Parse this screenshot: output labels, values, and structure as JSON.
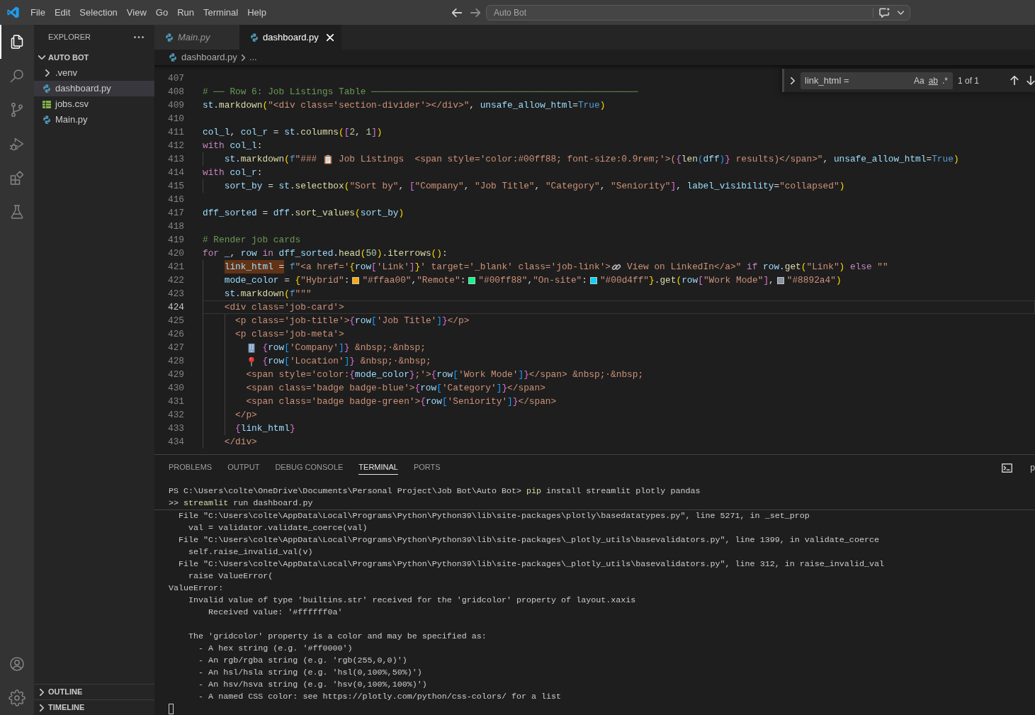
{
  "title_bar": {
    "menu": [
      "File",
      "Edit",
      "Selection",
      "View",
      "Go",
      "Run",
      "Terminal",
      "Help"
    ],
    "command_center": "Auto Bot"
  },
  "activity_bar": {
    "items": [
      {
        "kind": "files",
        "selected": true
      },
      {
        "kind": "search",
        "selected": false
      },
      {
        "kind": "source_control",
        "selected": false
      },
      {
        "kind": "run_debug",
        "selected": false
      },
      {
        "kind": "extensions",
        "selected": false
      },
      {
        "kind": "testing",
        "selected": false
      }
    ],
    "bottom": [
      {
        "kind": "account"
      },
      {
        "kind": "settings"
      }
    ]
  },
  "sidebar": {
    "title": "EXPLORER",
    "root": {
      "name": "AUTO BOT",
      "expanded": true
    },
    "items": [
      {
        "name": ".venv",
        "kind": "folder",
        "expanded": false,
        "selected": false
      },
      {
        "name": "dashboard.py",
        "kind": "python",
        "selected": true
      },
      {
        "name": "jobs.csv",
        "kind": "csv",
        "selected": false
      },
      {
        "name": "Main.py",
        "kind": "python",
        "selected": false
      }
    ],
    "sections": [
      {
        "name": "OUTLINE",
        "expanded": false
      },
      {
        "name": "TIMELINE",
        "expanded": false
      }
    ]
  },
  "editor": {
    "tabs": [
      {
        "label": "Main.py",
        "selected": false,
        "preview": true
      },
      {
        "label": "dashboard.py",
        "selected": true,
        "preview": false
      }
    ],
    "breadcrumb": [
      "dashboard.py",
      "..."
    ],
    "find": {
      "query": "link_html =",
      "options": [
        {
          "label": "Aa",
          "underlined": false
        },
        {
          "label": "ab",
          "underlined": true
        },
        {
          "label": ".*",
          "underlined": false
        }
      ],
      "result": "1 of 1"
    },
    "lines": [
      {
        "number": "407",
        "current": false
      },
      {
        "number": "408",
        "current": false,
        "tokens": [
          {
            "kind": "comment",
            "text": "# ── Row 6: Job Listings Table ─────────────────────────────────────────────────"
          }
        ]
      },
      {
        "number": "409",
        "current": false,
        "tokens": [
          {
            "kind": "var",
            "text": "st."
          },
          {
            "kind": "func",
            "text": "markdown"
          },
          {
            "kind": "b1",
            "text": "("
          },
          {
            "kind": "str",
            "text": "\"<div class='section-divider'></div>\""
          },
          {
            "kind": "plain",
            "text": ", "
          },
          {
            "kind": "var",
            "text": "unsafe_allow_html"
          },
          {
            "kind": "plain",
            "text": "="
          },
          {
            "kind": "const",
            "text": "True"
          },
          {
            "kind": "b1",
            "text": ")"
          }
        ]
      },
      {
        "number": "410",
        "current": false
      },
      {
        "number": "411",
        "current": false,
        "tokens": [
          {
            "kind": "var",
            "text": "col_l"
          },
          {
            "kind": "plain",
            "text": ", "
          },
          {
            "kind": "var",
            "text": "col_r"
          },
          {
            "kind": "plain",
            "text": " = "
          },
          {
            "kind": "var",
            "text": "st."
          },
          {
            "kind": "func",
            "text": "columns"
          },
          {
            "kind": "b1",
            "text": "("
          },
          {
            "kind": "b2",
            "text": "["
          },
          {
            "kind": "num",
            "text": "2"
          },
          {
            "kind": "plain",
            "text": ", "
          },
          {
            "kind": "num",
            "text": "1"
          },
          {
            "kind": "b2",
            "text": "]"
          },
          {
            "kind": "b1",
            "text": ")"
          }
        ]
      },
      {
        "number": "412",
        "current": false,
        "tokens": [
          {
            "kind": "kw",
            "text": "with"
          },
          {
            "kind": "var",
            "text": " col_l"
          },
          {
            "kind": "plain",
            "text": ":"
          }
        ],
        "children": [
          {
            "number": "413",
            "current": false,
            "tokens": [
              {
                "kind": "var",
                "text": "st."
              },
              {
                "kind": "func",
                "text": "markdown"
              },
              {
                "kind": "b1",
                "text": "("
              },
              {
                "kind": "const",
                "text": "f"
              },
              {
                "kind": "str",
                "text": "\"### "
              },
              {
                "kind": "clipboard"
              },
              {
                "kind": "str",
                "text": " Job Listings  <span style='color:#00ff88; font-size:0.9rem;'>("
              },
              {
                "kind": "b2",
                "text": "{"
              },
              {
                "kind": "func",
                "text": "len"
              },
              {
                "kind": "b3",
                "text": "("
              },
              {
                "kind": "var",
                "text": "dff"
              },
              {
                "kind": "b3",
                "text": ")"
              },
              {
                "kind": "b2",
                "text": "}"
              },
              {
                "kind": "str",
                "text": " results)</span>\""
              },
              {
                "kind": "plain",
                "text": ", "
              },
              {
                "kind": "var",
                "text": "unsafe_allow_html"
              },
              {
                "kind": "plain",
                "text": "="
              },
              {
                "kind": "const",
                "text": "True"
              },
              {
                "kind": "b1",
                "text": ")"
              }
            ]
          }
        ]
      },
      {
        "number": "414",
        "current": false,
        "tokens": [
          {
            "kind": "kw",
            "text": "with"
          },
          {
            "kind": "var",
            "text": " col_r"
          },
          {
            "kind": "plain",
            "text": ":"
          }
        ],
        "children": [
          {
            "number": "415",
            "current": false,
            "tokens": [
              {
                "kind": "var",
                "text": "sort_by"
              },
              {
                "kind": "plain",
                "text": " = "
              },
              {
                "kind": "var",
                "text": "st."
              },
              {
                "kind": "func",
                "text": "selectbox"
              },
              {
                "kind": "b1",
                "text": "("
              },
              {
                "kind": "str",
                "text": "\"Sort by\""
              },
              {
                "kind": "plain",
                "text": ", "
              },
              {
                "kind": "b2",
                "text": "["
              },
              {
                "kind": "str",
                "text": "\"Company\""
              },
              {
                "kind": "plain",
                "text": ", "
              },
              {
                "kind": "str",
                "text": "\"Job Title\""
              },
              {
                "kind": "plain",
                "text": ", "
              },
              {
                "kind": "str",
                "text": "\"Category\""
              },
              {
                "kind": "plain",
                "text": ", "
              },
              {
                "kind": "str",
                "text": "\"Seniority\""
              },
              {
                "kind": "b2",
                "text": "]"
              },
              {
                "kind": "plain",
                "text": ", "
              },
              {
                "kind": "var",
                "text": "label_visibility"
              },
              {
                "kind": "plain",
                "text": "="
              },
              {
                "kind": "str",
                "text": "\"collapsed\""
              },
              {
                "kind": "b1",
                "text": ")"
              }
            ]
          }
        ]
      },
      {
        "number": "416",
        "current": false
      },
      {
        "number": "417",
        "current": false,
        "tokens": [
          {
            "kind": "var",
            "text": "dff_sorted"
          },
          {
            "kind": "plain",
            "text": " = "
          },
          {
            "kind": "var",
            "text": "dff."
          },
          {
            "kind": "func",
            "text": "sort_values"
          },
          {
            "kind": "b1",
            "text": "("
          },
          {
            "kind": "var",
            "text": "sort_by"
          },
          {
            "kind": "b1",
            "text": ")"
          }
        ]
      },
      {
        "number": "418",
        "current": false
      },
      {
        "number": "419",
        "current": false,
        "tokens": [
          {
            "kind": "comment",
            "text": "# Render job cards"
          }
        ]
      },
      {
        "number": "420",
        "current": false,
        "tokens": [
          {
            "kind": "kw",
            "text": "for"
          },
          {
            "kind": "var",
            "text": " _"
          },
          {
            "kind": "plain",
            "text": ", "
          },
          {
            "kind": "var",
            "text": "row"
          },
          {
            "kind": "kw",
            "text": " in"
          },
          {
            "kind": "var",
            "text": " dff_sorted."
          },
          {
            "kind": "func",
            "text": "head"
          },
          {
            "kind": "b1",
            "text": "("
          },
          {
            "kind": "num",
            "text": "50"
          },
          {
            "kind": "b1",
            "text": ")"
          },
          {
            "kind": "plain",
            "text": "."
          },
          {
            "kind": "func",
            "text": "iterrows"
          },
          {
            "kind": "b1",
            "text": "()"
          },
          {
            "kind": "plain",
            "text": ":"
          }
        ],
        "children": [
          {
            "number": "421",
            "current": false,
            "tokens": [
              {
                "kind": "var",
                "text": "link_html",
                "highlighted": true
              },
              {
                "kind": "plain",
                "text": " =",
                "highlighted": true
              },
              {
                "kind": "const",
                "text": " f"
              },
              {
                "kind": "str",
                "text": "\"<a href='"
              },
              {
                "kind": "b1",
                "text": "{"
              },
              {
                "kind": "var",
                "text": "row"
              },
              {
                "kind": "b2",
                "text": "["
              },
              {
                "kind": "str",
                "text": "'Link'"
              },
              {
                "kind": "b2",
                "text": "]"
              },
              {
                "kind": "b1",
                "text": "}"
              },
              {
                "kind": "str",
                "text": "' target='_blank' class='job-link'>"
              },
              {
                "kind": "link"
              },
              {
                "kind": "str",
                "text": " View on LinkedIn</a>\""
              },
              {
                "kind": "kw",
                "text": " if"
              },
              {
                "kind": "var",
                "text": " row."
              },
              {
                "kind": "func",
                "text": "get"
              },
              {
                "kind": "b1",
                "text": "("
              },
              {
                "kind": "str",
                "text": "\"Link\""
              },
              {
                "kind": "b1",
                "text": ")"
              },
              {
                "kind": "kw",
                "text": " else"
              },
              {
                "kind": "str",
                "text": " \"\""
              }
            ]
          },
          {
            "number": "422",
            "current": false,
            "tokens": [
              {
                "kind": "var",
                "text": "mode_color"
              },
              {
                "kind": "plain",
                "text": " = "
              },
              {
                "kind": "b1",
                "text": "{"
              },
              {
                "kind": "str",
                "text": "\"Hybrid\""
              },
              {
                "kind": "plain",
                "text": ":"
              },
              {
                "kind": "swatch",
                "color": "#ffaa00"
              },
              {
                "kind": "str",
                "text": "\"#ffaa00\""
              },
              {
                "kind": "plain",
                "text": ","
              },
              {
                "kind": "str",
                "text": "\"Remote\""
              },
              {
                "kind": "plain",
                "text": ":"
              },
              {
                "kind": "swatch",
                "color": "#00ff88"
              },
              {
                "kind": "str",
                "text": "\"#00ff88\""
              },
              {
                "kind": "plain",
                "text": ","
              },
              {
                "kind": "str",
                "text": "\"On-site\""
              },
              {
                "kind": "plain",
                "text": ":"
              },
              {
                "kind": "swatch",
                "color": "#00d4ff"
              },
              {
                "kind": "str",
                "text": "\"#00d4ff\""
              },
              {
                "kind": "b1",
                "text": "}"
              },
              {
                "kind": "plain",
                "text": "."
              },
              {
                "kind": "func",
                "text": "get"
              },
              {
                "kind": "b1",
                "text": "("
              },
              {
                "kind": "var",
                "text": "row"
              },
              {
                "kind": "b2",
                "text": "["
              },
              {
                "kind": "str",
                "text": "\"Work Mode\""
              },
              {
                "kind": "b2",
                "text": "]"
              },
              {
                "kind": "plain",
                "text": ","
              },
              {
                "kind": "swatch",
                "color": "#8892a4"
              },
              {
                "kind": "str",
                "text": "\"#8892a4\""
              },
              {
                "kind": "b1",
                "text": ")"
              }
            ]
          },
          {
            "number": "423",
            "current": false,
            "tokens": [
              {
                "kind": "var",
                "text": "st."
              },
              {
                "kind": "func",
                "text": "markdown"
              },
              {
                "kind": "b1",
                "text": "("
              },
              {
                "kind": "const",
                "text": "f"
              },
              {
                "kind": "str",
                "text": "\"\"\""
              }
            ]
          },
          {
            "number": "424",
            "current": true,
            "tokens": [
              {
                "kind": "str",
                "text": "<div class='job-card'>"
              }
            ],
            "children": [
              {
                "number": "425",
                "current": false,
                "tokens": [
                  {
                    "kind": "str",
                    "text": "<p class='job-title'>"
                  },
                  {
                    "kind": "b2",
                    "text": "{"
                  },
                  {
                    "kind": "var",
                    "text": "row"
                  },
                  {
                    "kind": "b3",
                    "text": "["
                  },
                  {
                    "kind": "str",
                    "text": "'Job Title'"
                  },
                  {
                    "kind": "b3",
                    "text": "]"
                  },
                  {
                    "kind": "b2",
                    "text": "}"
                  },
                  {
                    "kind": "str",
                    "text": "</p>"
                  }
                ]
              },
              {
                "number": "426",
                "current": false,
                "tokens": [
                  {
                    "kind": "str",
                    "text": "<p class='job-meta'>"
                  }
                ],
                "children": [
                  {
                    "number": "427",
                    "current": false,
                    "tokens": [
                      {
                        "kind": "building"
                      },
                      {
                        "kind": "b2",
                        "text": " {"
                      },
                      {
                        "kind": "var",
                        "text": "row"
                      },
                      {
                        "kind": "b3",
                        "text": "["
                      },
                      {
                        "kind": "str",
                        "text": "'Company'"
                      },
                      {
                        "kind": "b3",
                        "text": "]"
                      },
                      {
                        "kind": "b2",
                        "text": "}"
                      },
                      {
                        "kind": "str",
                        "text": " &nbsp;·&nbsp;"
                      }
                    ]
                  },
                  {
                    "number": "428",
                    "current": false,
                    "tokens": [
                      {
                        "kind": "pin"
                      },
                      {
                        "kind": "b2",
                        "text": " {"
                      },
                      {
                        "kind": "var",
                        "text": "row"
                      },
                      {
                        "kind": "b3",
                        "text": "["
                      },
                      {
                        "kind": "str",
                        "text": "'Location'"
                      },
                      {
                        "kind": "b3",
                        "text": "]"
                      },
                      {
                        "kind": "b2",
                        "text": "}"
                      },
                      {
                        "kind": "str",
                        "text": " &nbsp;·&nbsp;"
                      }
                    ]
                  },
                  {
                    "number": "429",
                    "current": false,
                    "tokens": [
                      {
                        "kind": "str",
                        "text": "<span style='color:"
                      },
                      {
                        "kind": "b2",
                        "text": "{"
                      },
                      {
                        "kind": "var",
                        "text": "mode_color"
                      },
                      {
                        "kind": "b2",
                        "text": "}"
                      },
                      {
                        "kind": "str",
                        "text": ";'>"
                      },
                      {
                        "kind": "b2",
                        "text": "{"
                      },
                      {
                        "kind": "var",
                        "text": "row"
                      },
                      {
                        "kind": "b3",
                        "text": "["
                      },
                      {
                        "kind": "str",
                        "text": "'Work Mode'"
                      },
                      {
                        "kind": "b3",
                        "text": "]"
                      },
                      {
                        "kind": "b2",
                        "text": "}"
                      },
                      {
                        "kind": "str",
                        "text": "</span> &nbsp;·&nbsp;"
                      }
                    ]
                  },
                  {
                    "number": "430",
                    "current": false,
                    "tokens": [
                      {
                        "kind": "str",
                        "text": "<span class='badge badge-blue'>"
                      },
                      {
                        "kind": "b2",
                        "text": "{"
                      },
                      {
                        "kind": "var",
                        "text": "row"
                      },
                      {
                        "kind": "b3",
                        "text": "["
                      },
                      {
                        "kind": "str",
                        "text": "'Category'"
                      },
                      {
                        "kind": "b3",
                        "text": "]"
                      },
                      {
                        "kind": "b2",
                        "text": "}"
                      },
                      {
                        "kind": "str",
                        "text": "</span>"
                      }
                    ]
                  },
                  {
                    "number": "431",
                    "current": false,
                    "tokens": [
                      {
                        "kind": "str",
                        "text": "<span class='badge badge-green'>"
                      },
                      {
                        "kind": "b2",
                        "text": "{"
                      },
                      {
                        "kind": "var",
                        "text": "row"
                      },
                      {
                        "kind": "b3",
                        "text": "["
                      },
                      {
                        "kind": "str",
                        "text": "'Seniority'"
                      },
                      {
                        "kind": "b3",
                        "text": "]"
                      },
                      {
                        "kind": "b2",
                        "text": "}"
                      },
                      {
                        "kind": "str",
                        "text": "</span>"
                      }
                    ]
                  }
                ]
              },
              {
                "number": "432",
                "current": false,
                "tokens": [
                  {
                    "kind": "str",
                    "text": "</p>"
                  }
                ]
              },
              {
                "number": "433",
                "current": false,
                "tokens": [
                  {
                    "kind": "b2",
                    "text": "{"
                  },
                  {
                    "kind": "var",
                    "text": "link_html"
                  },
                  {
                    "kind": "b2",
                    "text": "}"
                  }
                ]
              }
            ]
          },
          {
            "number": "434",
            "current": false,
            "tokens": [
              {
                "kind": "str",
                "text": "</div>"
              }
            ]
          }
        ]
      }
    ]
  },
  "panel": {
    "tabs": [
      {
        "label": "PROBLEMS",
        "selected": false
      },
      {
        "label": "OUTPUT",
        "selected": false
      },
      {
        "label": "DEBUG CONSOLE",
        "selected": false
      },
      {
        "label": "TERMINAL",
        "selected": true
      },
      {
        "label": "PORTS",
        "selected": false
      }
    ],
    "terminal_name": "p",
    "terminal": {
      "sticky": [
        {
          "tokens": [
            {
              "kind": "plain",
              "text": "PS C:\\Users\\colte\\OneDrive\\Documents\\Personal Project\\Job Bot\\Auto Bot> "
            },
            {
              "kind": "command",
              "text": "pip"
            },
            {
              "kind": "plain",
              "text": " install streamlit plotly pandas"
            }
          ]
        },
        {
          "tokens": [
            {
              "kind": "plain",
              "text": ">> "
            },
            {
              "kind": "command",
              "text": "streamlit"
            },
            {
              "kind": "plain",
              "text": " run dashboard.py"
            }
          ]
        }
      ],
      "blocks": [
        {
          "lines": [
            "  File \"C:\\Users\\colte\\AppData\\Local\\Programs\\Python\\Python39\\lib\\site-packages\\plotly\\basedatatypes.py\", line 5271, in _set_prop",
            "    val = validator.validate_coerce(val)",
            "  File \"C:\\Users\\colte\\AppData\\Local\\Programs\\Python\\Python39\\lib\\site-packages\\_plotly_utils\\basevalidators.py\", line 1399, in validate_coerce",
            "    self.raise_invalid_val(v)",
            "  File \"C:\\Users\\colte\\AppData\\Local\\Programs\\Python\\Python39\\lib\\site-packages\\_plotly_utils\\basevalidators.py\", line 312, in raise_invalid_val",
            "    raise ValueError(",
            "ValueError:",
            "    Invalid value of type 'builtins.str' received for the 'gridcolor' property of layout.xaxis",
            "        Received value: '#ffffff0a'"
          ]
        },
        {
          "lines": [
            "    The 'gridcolor' property is a color and may be specified as:",
            "      - A hex string (e.g. '#ff0000')",
            "      - An rgb/rgba string (e.g. 'rgb(255,0,0)')",
            "      - An hsl/hsla string (e.g. 'hsl(0,100%,50%)')",
            "      - An hsv/hsva string (e.g. 'hsv(0,100%,100%)')",
            "      - A named CSS color: see https://plotly.com/python/css-colors/ for a list"
          ]
        }
      ]
    }
  }
}
